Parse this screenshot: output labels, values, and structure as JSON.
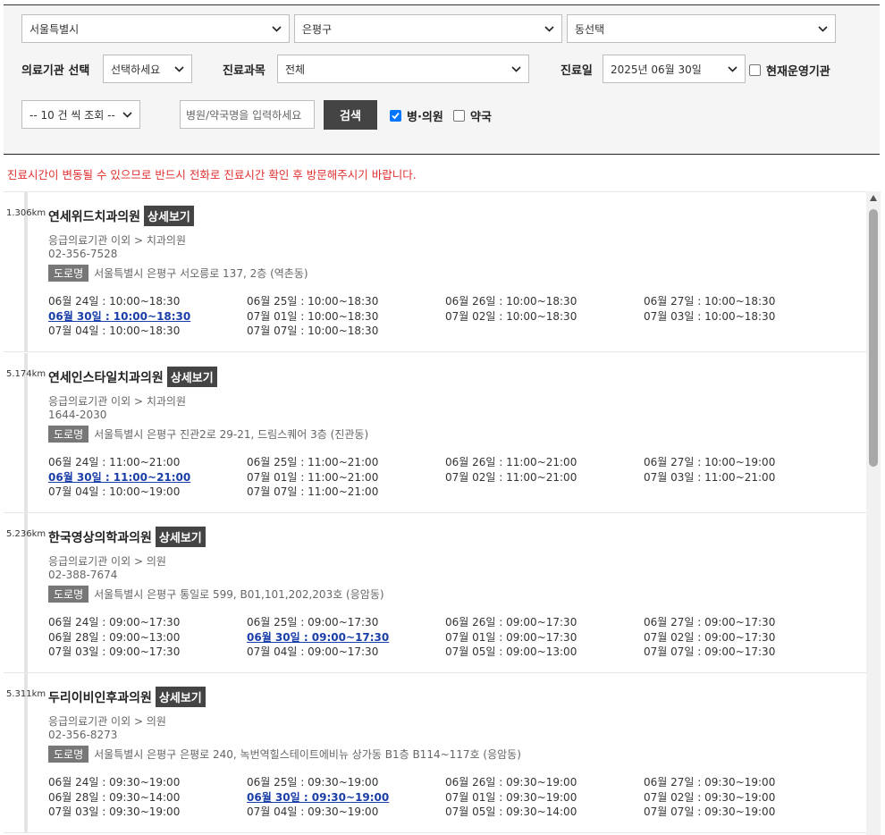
{
  "filters": {
    "region": "서울특별시",
    "district": "은평구",
    "dong": "동선택",
    "facility_label": "의료기관 선택",
    "facility_value": "선택하세요",
    "dept_label": "진료과목",
    "dept_value": "전체",
    "date_label": "진료일",
    "date_value": "2025년 06월 30일",
    "open_now_label": "현재운영기관",
    "page_size": "-- 10 건 씩 조회 --",
    "search_placeholder": "병원/약국명을 입력하세요",
    "search_button": "검색",
    "hospital_label": "병·의원",
    "pharmacy_label": "약국"
  },
  "notice": "진료시간이 변동될 수 있으므로 반드시 전화로 진료시간 확인 후 방문해주시기 바랍니다.",
  "common": {
    "detail_label": "상세보기",
    "road_label": "도로명"
  },
  "hospitals": [
    {
      "distance": "1.306km",
      "name": "연세위드치과의원",
      "category": "응급의료기관 이외 > 치과의원",
      "phone": "02-356-7528",
      "address": "서울특별시 은평구 서오릉로 137, 2층 (역촌동)",
      "schedule": [
        {
          "text": "06월 24일 : 10:00~18:30",
          "today": false
        },
        {
          "text": "06월 25일 : 10:00~18:30",
          "today": false
        },
        {
          "text": "06월 26일 : 10:00~18:30",
          "today": false
        },
        {
          "text": "06월 27일 : 10:00~18:30",
          "today": false
        },
        {
          "text": "06월 30일 : 10:00~18:30",
          "today": true
        },
        {
          "text": "07월 01일 : 10:00~18:30",
          "today": false
        },
        {
          "text": "07월 02일 : 10:00~18:30",
          "today": false
        },
        {
          "text": "07월 03일 : 10:00~18:30",
          "today": false
        },
        {
          "text": "07월 04일 : 10:00~18:30",
          "today": false
        },
        {
          "text": "07월 07일 : 10:00~18:30",
          "today": false
        }
      ]
    },
    {
      "distance": "5.174km",
      "name": "연세인스타일치과의원",
      "category": "응급의료기관 이외 > 치과의원",
      "phone": "1644-2030",
      "address": "서울특별시 은평구 진관2로 29-21, 드림스퀘어 3층 (진관동)",
      "schedule": [
        {
          "text": "06월 24일 : 11:00~21:00",
          "today": false
        },
        {
          "text": "06월 25일 : 11:00~21:00",
          "today": false
        },
        {
          "text": "06월 26일 : 11:00~21:00",
          "today": false
        },
        {
          "text": "06월 27일 : 10:00~19:00",
          "today": false
        },
        {
          "text": "06월 30일 : 11:00~21:00",
          "today": true
        },
        {
          "text": "07월 01일 : 11:00~21:00",
          "today": false
        },
        {
          "text": "07월 02일 : 11:00~21:00",
          "today": false
        },
        {
          "text": "07월 03일 : 11:00~21:00",
          "today": false
        },
        {
          "text": "07월 04일 : 10:00~19:00",
          "today": false
        },
        {
          "text": "07월 07일 : 11:00~21:00",
          "today": false
        }
      ]
    },
    {
      "distance": "5.236km",
      "name": "한국영상의학과의원",
      "category": "응급의료기관 이외 > 의원",
      "phone": "02-388-7674",
      "address": "서울특별시 은평구 통일로 599, B01,101,202,203호 (응암동)",
      "schedule": [
        {
          "text": "06월 24일 : 09:00~17:30",
          "today": false
        },
        {
          "text": "06월 25일 : 09:00~17:30",
          "today": false
        },
        {
          "text": "06월 26일 : 09:00~17:30",
          "today": false
        },
        {
          "text": "06월 27일 : 09:00~17:30",
          "today": false
        },
        {
          "text": "06월 28일 : 09:00~13:00",
          "today": false
        },
        {
          "text": "06월 30일 : 09:00~17:30",
          "today": true
        },
        {
          "text": "07월 01일 : 09:00~17:30",
          "today": false
        },
        {
          "text": "07월 02일 : 09:00~17:30",
          "today": false
        },
        {
          "text": "07월 03일 : 09:00~17:30",
          "today": false
        },
        {
          "text": "07월 04일 : 09:00~17:30",
          "today": false
        },
        {
          "text": "07월 05일 : 09:00~13:00",
          "today": false
        },
        {
          "text": "07월 07일 : 09:00~17:30",
          "today": false
        }
      ]
    },
    {
      "distance": "5.311km",
      "name": "두리이비인후과의원",
      "category": "응급의료기관 이외 > 의원",
      "phone": "02-356-8273",
      "address": "서울특별시 은평구 은평로 240, 녹번역힐스테이트에비뉴 상가동 B1층 B114~117호 (응암동)",
      "schedule": [
        {
          "text": "06월 24일 : 09:30~19:00",
          "today": false
        },
        {
          "text": "06월 25일 : 09:30~19:00",
          "today": false
        },
        {
          "text": "06월 26일 : 09:30~19:00",
          "today": false
        },
        {
          "text": "06월 27일 : 09:30~19:00",
          "today": false
        },
        {
          "text": "06월 28일 : 09:30~14:00",
          "today": false
        },
        {
          "text": "06월 30일 : 09:30~19:00",
          "today": true
        },
        {
          "text": "07월 01일 : 09:30~19:00",
          "today": false
        },
        {
          "text": "07월 02일 : 09:30~19:00",
          "today": false
        },
        {
          "text": "07월 03일 : 09:30~19:00",
          "today": false
        },
        {
          "text": "07월 04일 : 09:30~19:00",
          "today": false
        },
        {
          "text": "07월 05일 : 09:30~14:00",
          "today": false
        },
        {
          "text": "07월 07일 : 09:30~19:00",
          "today": false
        }
      ]
    }
  ]
}
